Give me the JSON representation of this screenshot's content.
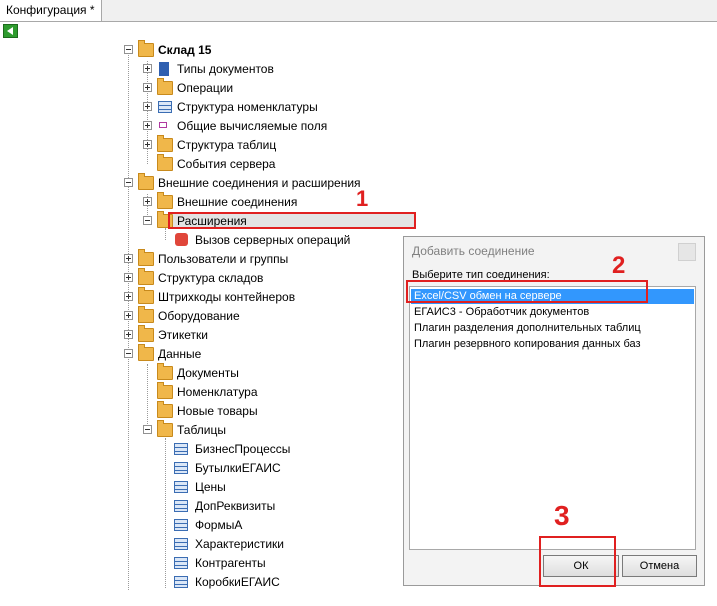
{
  "tab": {
    "label": "Конфигурация *"
  },
  "tree": {
    "root": "Склад 15",
    "doc_types": "Типы документов",
    "operations": "Операции",
    "nomenclature_structure": "Структура номенклатуры",
    "common_fields": "Общие вычисляемые поля",
    "table_structure": "Структура таблиц",
    "server_events": "События сервера",
    "external_and_ext": "Внешние соединения и расширения",
    "external_connections": "Внешние соединения",
    "extensions": "Расширения",
    "server_ops_call": "Вызов серверных операций",
    "users_groups": "Пользователи и группы",
    "warehouse_structure": "Структура складов",
    "container_barcodes": "Штрихкоды контейнеров",
    "equipment": "Оборудование",
    "labels": "Этикетки",
    "data": "Данные",
    "documents": "Документы",
    "nomenclature": "Номенклатура",
    "new_goods": "Новые товары",
    "tables": "Таблицы",
    "table_items": [
      "БизнесПроцессы",
      "БутылкиЕГАИС",
      "Цены",
      "ДопРеквизиты",
      "ФормыА",
      "Характеристики",
      "Контрагенты",
      "КоробкиЕГАИС"
    ]
  },
  "dialog": {
    "title": "Добавить соединение",
    "prompt": "Выберите тип соединения:",
    "options": [
      "Excel/CSV обмен на сервере",
      "ЕГАИС3 - Обработчик документов",
      "Плагин разделения дополнительных таблиц",
      "Плагин резервного копирования данных баз"
    ],
    "ok_label": "ОК",
    "cancel_label": "Отмена"
  },
  "annotations": {
    "n1": "1",
    "n2": "2",
    "n3": "3"
  },
  "colors": {
    "annotation": "#e02020",
    "selection": "#3297fd",
    "folder": "#f0b74a"
  }
}
